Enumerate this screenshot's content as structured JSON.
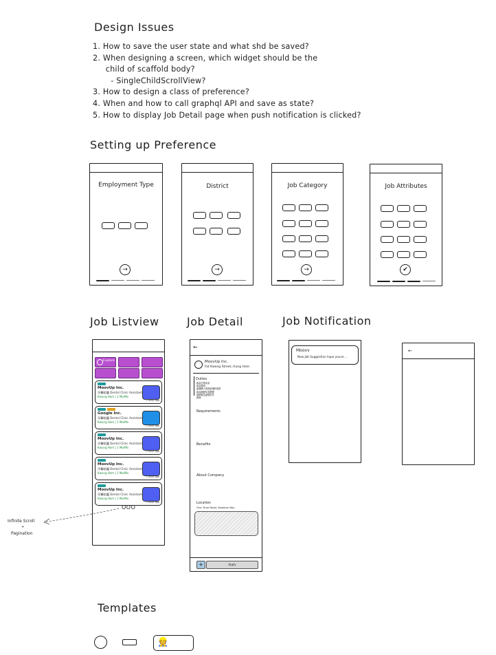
{
  "design_issues": {
    "heading": "Design Issues",
    "items": [
      "1. How to save the user state and what shd be saved?",
      "2. When designing a screen, which widget should be the",
      "     child of scaffold body?",
      "       - SingleChildScrollView?",
      "3. How to design a class of preference?",
      "4. When and how to call graphql API and save as state?",
      "5. How to display Job Detail page when push notification is clicked?"
    ]
  },
  "preference": {
    "heading": "Setting up Preference",
    "screens": [
      {
        "title": "Employment Type",
        "action_icon": "arrow-right-icon"
      },
      {
        "title": "District",
        "action_icon": "arrow-right-icon"
      },
      {
        "title": "Job Category",
        "action_icon": "arrow-right-icon"
      },
      {
        "title": "Job Attributes",
        "action_icon": "check-icon",
        "action_glyph": "✔"
      }
    ],
    "arrow_glyph": "→"
  },
  "job_listview": {
    "heading": "Job Listview",
    "first_tile": "Explore",
    "cards": [
      {
        "company": "MoovUp Inc.",
        "role": "牙醫助護 Dental Clinic Assistant",
        "location": "Kwung Hom | 1 Mo/Mo",
        "ago": "2 days ago",
        "logo_color": "#4f5ff2"
      },
      {
        "company": "Google Inc.",
        "role": "牙醫助護 Dental Clinic Assistant",
        "location": "Kwung Hom | 1 Mo/Mo",
        "ago": "2 days ago",
        "logo_color": "#1f8fe8"
      },
      {
        "company": "MoovUp Inc.",
        "role": "牙醫助護 Dental Clinic Assistant",
        "location": "Kwung Hom | 1 Mo/Mo",
        "ago": "2 days ago",
        "logo_color": "#4f5ff2"
      },
      {
        "company": "MoovUp Inc.",
        "role": "牙醫助護 Dental Clinic Assistant",
        "location": "Kwung Hom | 1 Mo/Mo",
        "ago": "2 days ago",
        "logo_color": "#4f5ff2"
      },
      {
        "company": "MoovUp Inc.",
        "role": "牙醫助護 Dental Clinic Assistant",
        "location": "Kwung Hom | 1 Mo/Mo",
        "ago": "2 days ago",
        "logo_color": "#4f5ff2"
      }
    ],
    "pagination_dots": "OOO",
    "annotation_line1": "Infinite Scroll",
    "annotation_plus": "+",
    "annotation_line2": "Pagination"
  },
  "job_detail": {
    "heading": "Job Detail",
    "back_glyph": "←",
    "company": "MoovUp Inc.",
    "address": "Fat Kwong Street, Hung Hom",
    "duties_label": "Duties",
    "duties": [
      "-負責日常清潔",
      "-負責接待",
      "-處理病人查詢及預約安排",
      "-負責病歷文書整理",
      "-協助醫生處理文件",
      "-其他"
    ],
    "requirements_label": "Requirements",
    "benefits_label": "Benefits",
    "about_label": "About Company",
    "location_label": "Location",
    "location_value": "One Time Road, Kowloon Bay",
    "plus_glyph": "+",
    "apply_label": "Apply"
  },
  "job_notification": {
    "heading": "Job Notification",
    "title": "Moovv",
    "body": "New Job Suggestion hope youve ...",
    "back_glyph": "←"
  },
  "templates": {
    "heading": "Templates",
    "emoji": "👷"
  }
}
